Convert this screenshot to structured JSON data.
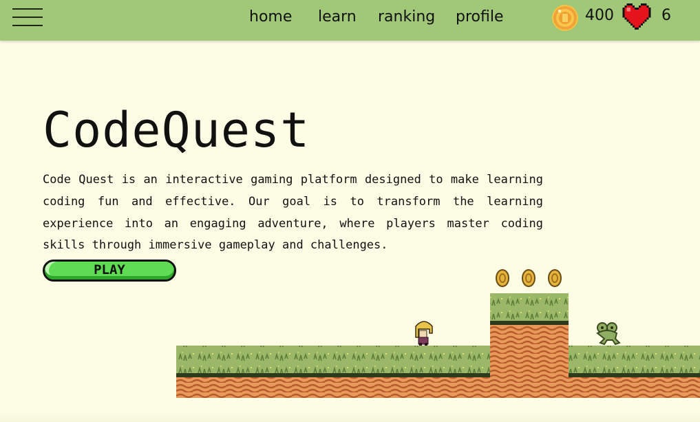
{
  "nav": {
    "menu_icon": "hamburger-menu-icon",
    "links": [
      {
        "label": "home"
      },
      {
        "label": "learn"
      },
      {
        "label": "ranking"
      },
      {
        "label": "profile"
      }
    ],
    "coins": "400",
    "lives": "6",
    "coin_icon": "coin-icon",
    "heart_icon": "heart-icon"
  },
  "hero": {
    "title": "CodeQuest",
    "description": "Code Quest is an interactive gaming platform designed to make learning coding fun and effective. Our goal is to transform the learning experience into an engaging adventure, where players master coding skills through immersive gameplay and challenges.",
    "play_label": "PLAY"
  },
  "scene": {
    "coins_shown": 3,
    "characters": [
      "player-character",
      "frog-enemy"
    ]
  },
  "colors": {
    "navbar": "#a0c878",
    "background": "#fdfde6",
    "play_button": "#5fdc54",
    "grass": "#9bb868",
    "dirt": "#e89a5a",
    "coin": "#e5b43c",
    "heart": "#d0141c"
  }
}
